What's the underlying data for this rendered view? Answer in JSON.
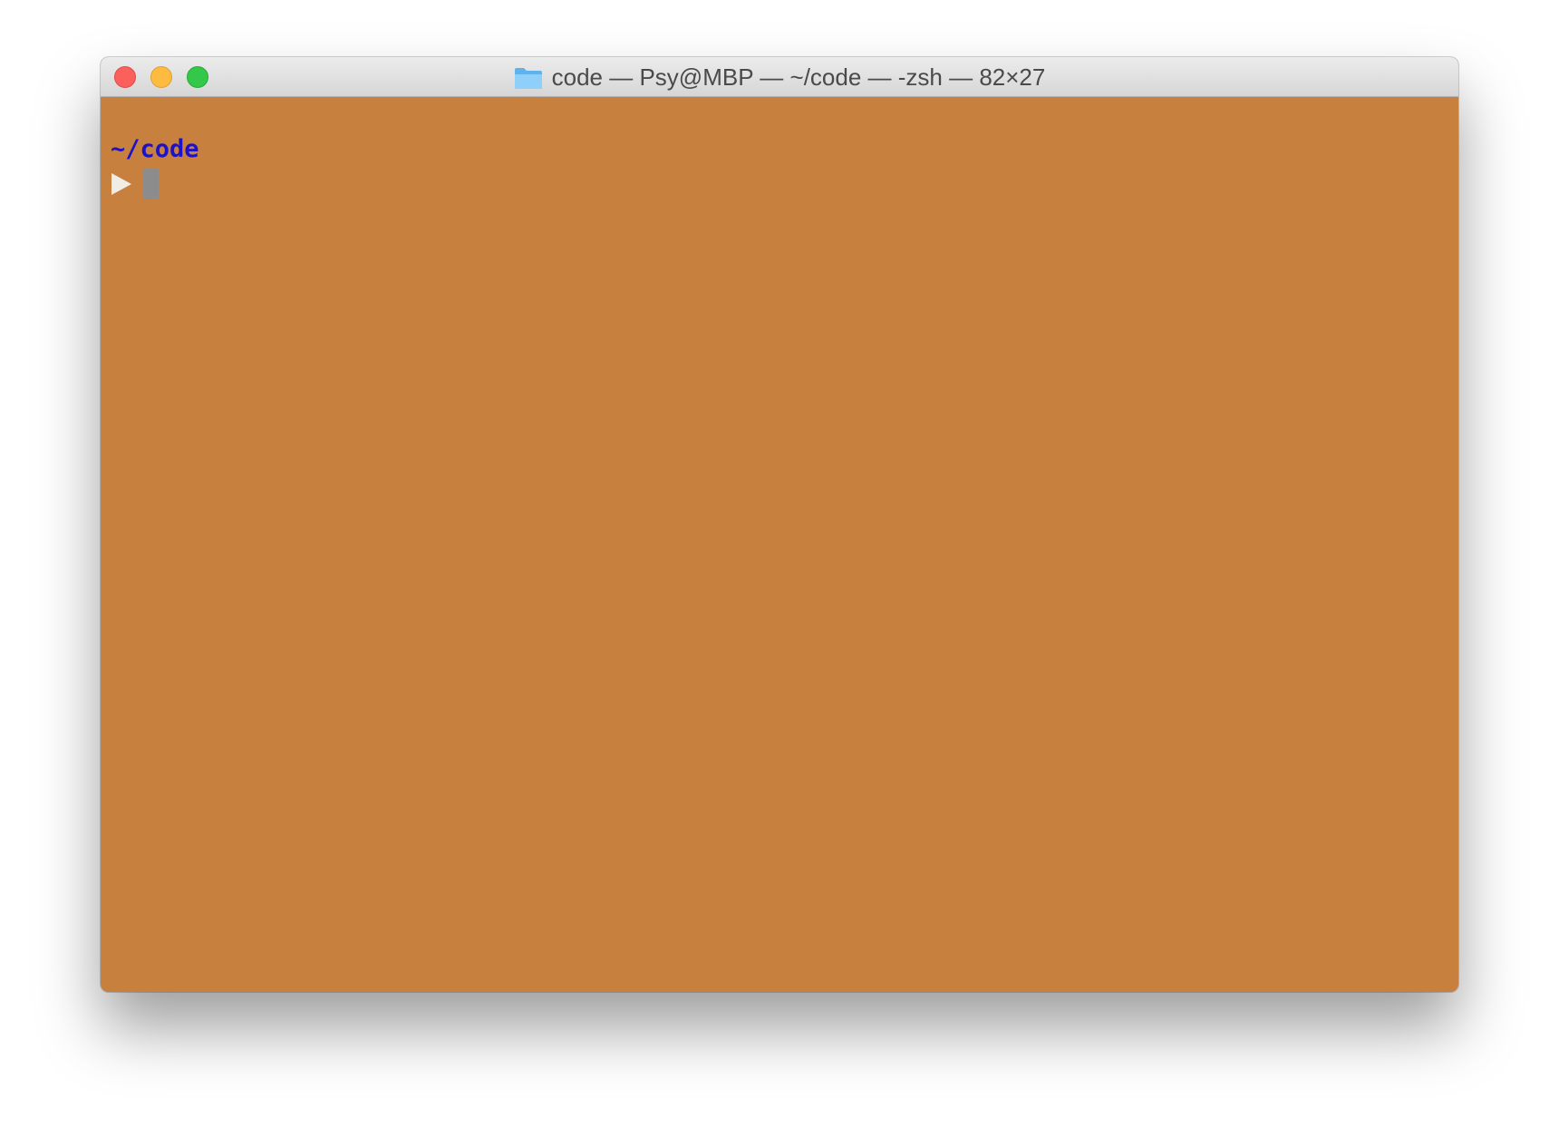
{
  "window": {
    "title": "code — Psy@MBP — ~/code — -zsh — 82×27",
    "title_icon": "folder-icon",
    "traffic_lights": {
      "close_color": "#fc605c",
      "minimize_color": "#fdbc40",
      "zoom_color": "#34c84a"
    }
  },
  "terminal": {
    "background_color": "#c8803f",
    "cwd_text": "~/code",
    "cwd_color": "#1d12c7",
    "prompt_symbol": "right-triangle-prompt-icon",
    "prompt_color": "#f0ece6",
    "cursor_color": "#8c8c8c"
  }
}
